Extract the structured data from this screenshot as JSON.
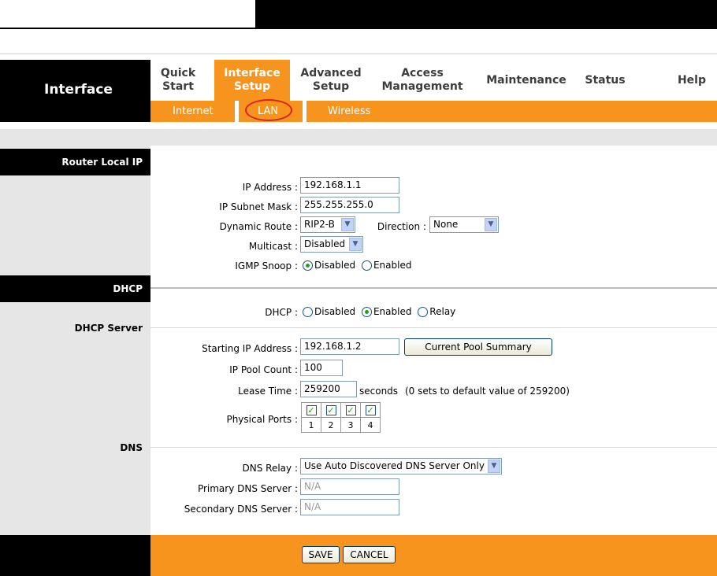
{
  "header": {
    "section_title": "Interface"
  },
  "nav": {
    "tabs": [
      {
        "line1": "Quick",
        "line2": "Start"
      },
      {
        "line1": "Interface",
        "line2": "Setup"
      },
      {
        "line1": "Advanced",
        "line2": "Setup"
      },
      {
        "line1": "Access",
        "line2": "Management"
      },
      {
        "line1": "Maintenance",
        "line2": ""
      },
      {
        "line1": "Status",
        "line2": ""
      },
      {
        "line1": "Help",
        "line2": ""
      }
    ],
    "subtabs": [
      "Internet",
      "LAN",
      "Wireless"
    ]
  },
  "sections": {
    "router_local_ip": "Router Local IP",
    "dhcp": "DHCP",
    "dhcp_server": "DHCP Server",
    "dns": "DNS"
  },
  "router": {
    "ip_label": "IP Address :",
    "ip_value": "192.168.1.1",
    "mask_label": "IP Subnet Mask :",
    "mask_value": "255.255.255.0",
    "route_label": "Dynamic Route :",
    "route_value": "RIP2-B",
    "direction_label": "Direction :",
    "direction_value": "None",
    "multicast_label": "Multicast :",
    "multicast_value": "Disabled",
    "igmp_label": "IGMP Snoop :",
    "igmp_disabled": "Disabled",
    "igmp_enabled": "Enabled"
  },
  "dhcp": {
    "label": "DHCP :",
    "opt_disabled": "Disabled",
    "opt_enabled": "Enabled",
    "opt_relay": "Relay",
    "start_label": "Starting IP Address :",
    "start_value": "192.168.1.2",
    "pool_button": "Current Pool Summary",
    "count_label": "IP Pool Count :",
    "count_value": "100",
    "lease_label": "Lease Time :",
    "lease_value": "259200",
    "lease_unit": "seconds",
    "lease_note": "(0 sets to default value of 259200)",
    "ports_label": "Physical Ports :",
    "ports": [
      "1",
      "2",
      "3",
      "4"
    ]
  },
  "dns": {
    "relay_label": "DNS Relay :",
    "relay_value": "Use Auto Discovered DNS Server Only",
    "primary_label": "Primary DNS Server :",
    "primary_value": "N/A",
    "secondary_label": "Secondary DNS Server :",
    "secondary_value": "N/A"
  },
  "actions": {
    "save": "SAVE",
    "cancel": "CANCEL"
  },
  "colors": {
    "accent": "#f7941d",
    "dark": "#000000",
    "panel": "#e6e6e6",
    "highlight_circle": "#e02020"
  }
}
